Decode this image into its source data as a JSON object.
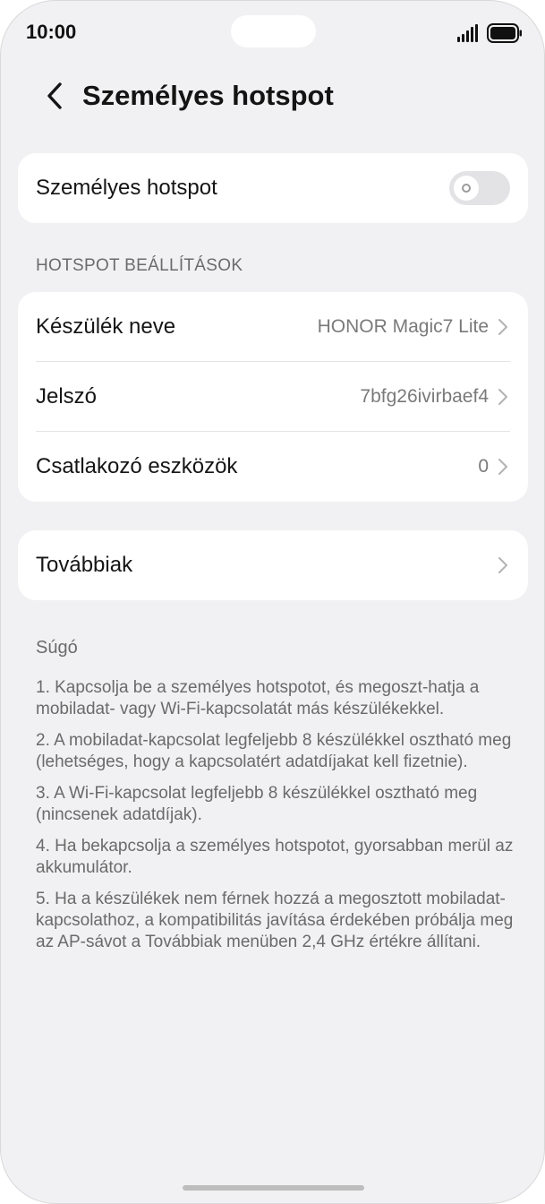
{
  "status_bar": {
    "time": "10:00"
  },
  "header": {
    "back_icon": "chevron-left-icon",
    "title": "Személyes hotspot"
  },
  "hotspot_toggle": {
    "label": "Személyes hotspot",
    "enabled": false
  },
  "settings_section": {
    "header": "HOTSPOT BEÁLLÍTÁSOK",
    "items": [
      {
        "label": "Készülék neve",
        "value": "HONOR Magic7 Lite"
      },
      {
        "label": "Jelszó",
        "value": "7bfg26ivirbaef4"
      },
      {
        "label": "Csatlakozó eszközök",
        "value": "0"
      }
    ]
  },
  "more": {
    "label": "Továbbiak"
  },
  "help": {
    "title": "Súgó",
    "items": [
      "1. Kapcsolja be a személyes hotspotot, és megoszt-hatja a mobiladat- vagy Wi-Fi-kapcsolatát más készülékekkel.",
      "2. A mobiladat-kapcsolat legfeljebb 8 készülékkel osztható meg (lehetséges, hogy a kapcsolatért adatdíjakat kell fizetnie).",
      "3. A Wi-Fi-kapcsolat legfeljebb 8 készülékkel osztható meg (nincsenek adatdíjak).",
      "4. Ha bekapcsolja a személyes hotspotot, gyorsabban merül az akkumulátor.",
      "5. Ha a készülékek nem férnek hozzá a megosztott mobiladat-kapcsolathoz, a kompatibilitás javítása érdekében próbálja meg az AP-sávot a Továbbiak menüben 2,4 GHz értékre állítani."
    ]
  },
  "colors": {
    "background": "#f1f1f3",
    "card": "#ffffff",
    "toggle_off": "#e3e3e5",
    "secondary_text": "#7a7a7a"
  }
}
